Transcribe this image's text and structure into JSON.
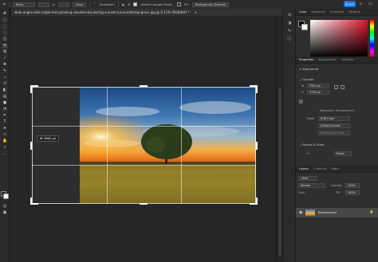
{
  "options_bar": {
    "ratio_label": "Ratio",
    "clear_label": "Clear",
    "straighten_label": "Straighten",
    "delete_cropped_label": "Delete Cropped Pixels",
    "fill_label": "Fill:",
    "fill_value": "Background (Default)",
    "share_label": "Share"
  },
  "document": {
    "tab_title": "wide-angle-shot-single-tree-growing-clouded-sky-during-sunset-surrounded-by-grass.jpg @ 8.11% (RGB/8#) *"
  },
  "canvas": {
    "width_label": "W: 8982 px"
  },
  "color_panel": {
    "tabs": [
      "Color",
      "Swatches",
      "Gradients",
      "Patterns"
    ],
    "fg_color": "#000000",
    "bg_color": "#ffffff"
  },
  "properties_panel": {
    "tabs": [
      "Properties",
      "Adjustments",
      "Libraries"
    ],
    "doc_label": "Document",
    "canvas_section": "Canvas",
    "w_value": "7952 px",
    "h_value": "5795 px",
    "resolution_text": "Resolution: 96 pixels/inch",
    "mode_label": "Mode",
    "mode_value": "RGB Color",
    "depth_value": "8 Bits/Channel",
    "fill_text": "Background Color",
    "rulers_section": "Rulers & Grids",
    "rulers_unit": "Pixels"
  },
  "layers_panel": {
    "tabs": [
      "Layers",
      "Channels",
      "Paths"
    ],
    "kind_placeholder": "Kind",
    "blend_value": "Normal",
    "opacity_label": "Opacity:",
    "opacity_value": "100%",
    "lock_label": "Lock:",
    "fill_label": "Fill:",
    "fill_value": "100%",
    "layer_name": "Background"
  },
  "colors": {
    "accent": "#1473e6"
  }
}
